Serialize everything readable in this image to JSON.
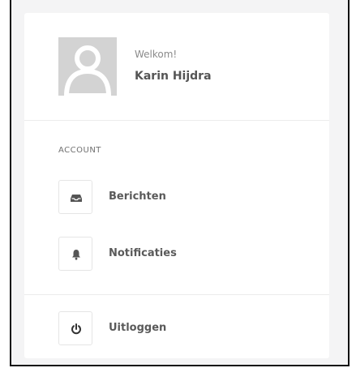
{
  "profile": {
    "greeting": "Welkom!",
    "name": "Karin Hijdra",
    "avatar_icon": "user-silhouette"
  },
  "account_section": {
    "heading": "ACCOUNT",
    "items": [
      {
        "label": "Berichten",
        "icon": "inbox-icon"
      },
      {
        "label": "Notificaties",
        "icon": "bell-icon"
      }
    ]
  },
  "logout": {
    "label": "Uitloggen",
    "icon": "power-icon"
  },
  "colors": {
    "background": "#f4f4f5",
    "panel": "#ffffff",
    "text": "#5a5a5a",
    "muted": "#8a8a8a",
    "avatar": "#d3d3d3"
  }
}
